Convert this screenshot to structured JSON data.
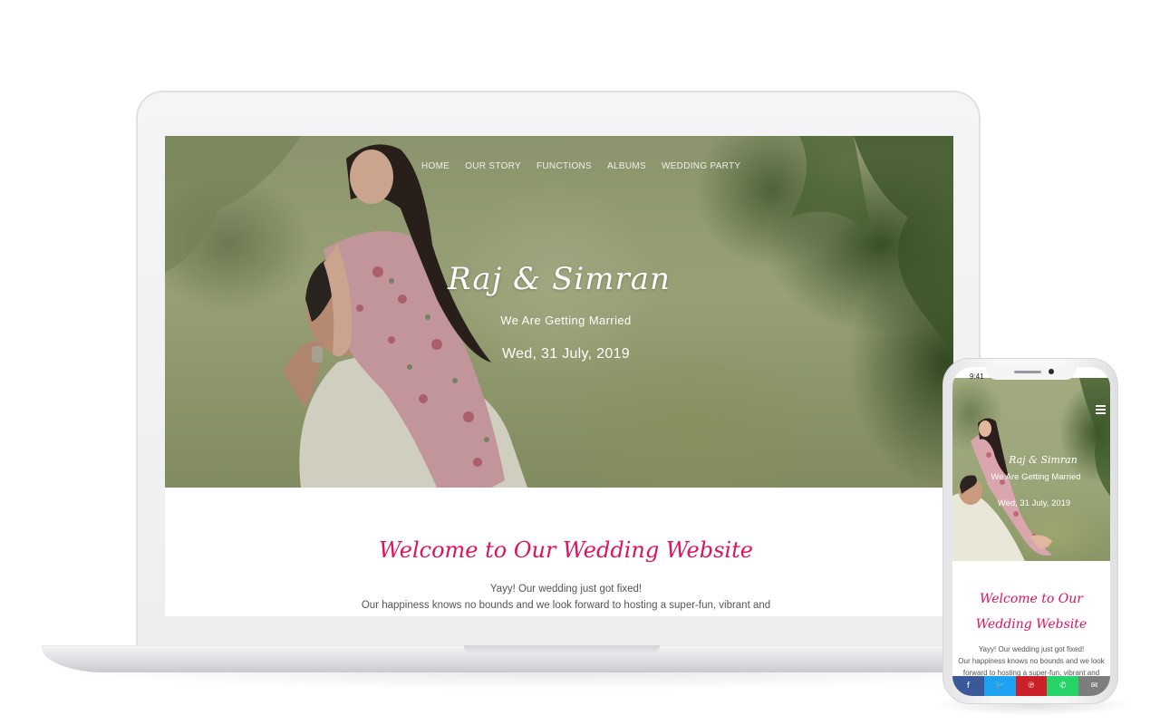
{
  "site": {
    "nav": [
      "HOME",
      "OUR STORY",
      "FUNCTIONS",
      "ALBUMS",
      "WEDDING PARTY"
    ],
    "couple_names": "Raj & Simran",
    "tagline": "We Are Getting Married",
    "date": "Wed, 31 July, 2019",
    "welcome_title": "Welcome to Our Wedding Website",
    "welcome_line1": "Yayy! Our wedding just got fixed!",
    "welcome_line2": "Our happiness knows no bounds and we look forward to hosting a super-fun, vibrant and"
  },
  "mobile": {
    "status_time": "9:41",
    "welcome_title_line1": "Welcome to Our",
    "welcome_title_line2": "Wedding Website",
    "text_line1": "Yayy! Our wedding just got fixed!",
    "text_line2": "Our happiness knows no bounds and we look",
    "text_line3": "forward to hosting a super-fun, vibrant and",
    "share_bar": [
      {
        "icon": "facebook-icon",
        "glyph": "f",
        "color": "#3b5998"
      },
      {
        "icon": "twitter-icon",
        "glyph": "🐦",
        "color": "#1da1f2"
      },
      {
        "icon": "pinterest-icon",
        "glyph": "℗",
        "color": "#cb2027"
      },
      {
        "icon": "whatsapp-icon",
        "glyph": "✆",
        "color": "#25d366"
      },
      {
        "icon": "email-icon",
        "glyph": "✉",
        "color": "#7d7d7d"
      }
    ]
  },
  "colors": {
    "accent": "#e0115f",
    "body_text": "#555555"
  }
}
